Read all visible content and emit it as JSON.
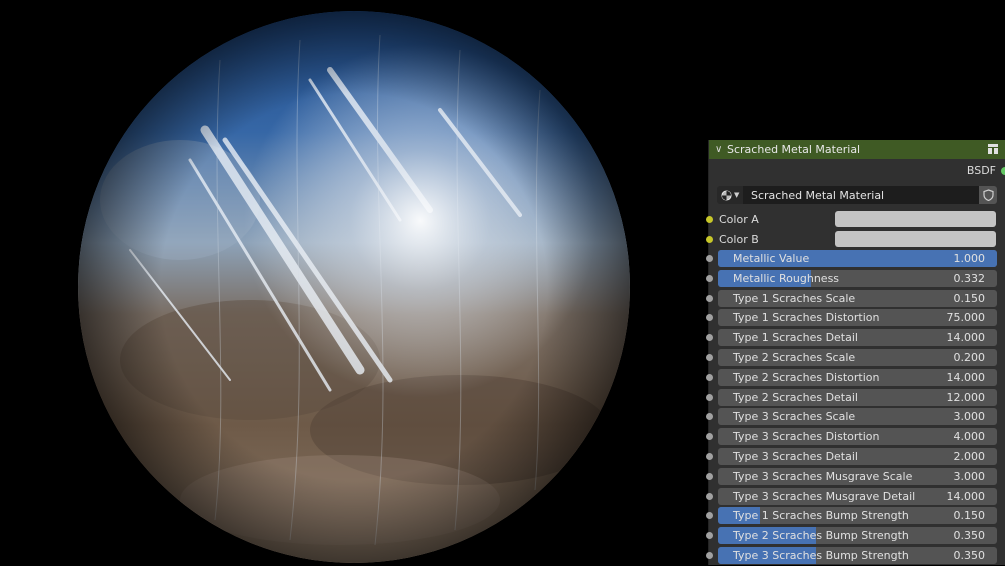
{
  "node": {
    "title": "Scrached Metal Material",
    "output_label": "BSDF",
    "group_name": "Scrached Metal Material",
    "colors": {
      "header": "#3f5a24",
      "body": "#303030",
      "field": "#545454",
      "fill": "#4772b3",
      "color_socket": "#c7c729",
      "float_socket": "#a1a1a1",
      "bsdf_socket": "#63c763"
    },
    "color_inputs": [
      {
        "label": "Color A",
        "swatch": "#c4c4c4"
      },
      {
        "label": "Color B",
        "swatch": "#c4c4c4"
      }
    ],
    "inputs": [
      {
        "label": "Metallic Value",
        "value": "1.000",
        "fill": 1.0
      },
      {
        "label": "Metallic Roughness",
        "value": "0.332",
        "fill": 0.332
      },
      {
        "label": "Type 1 Scraches Scale",
        "value": "0.150",
        "fill": 0
      },
      {
        "label": "Type 1 Scraches Distortion",
        "value": "75.000",
        "fill": 0
      },
      {
        "label": "Type 1 Scraches Detail",
        "value": "14.000",
        "fill": 0
      },
      {
        "label": "Type 2 Scraches Scale",
        "value": "0.200",
        "fill": 0
      },
      {
        "label": "Type 2 Scraches Distortion",
        "value": "14.000",
        "fill": 0
      },
      {
        "label": "Type 2 Scraches Detail",
        "value": "12.000",
        "fill": 0
      },
      {
        "label": "Type 3 Scraches Scale",
        "value": "3.000",
        "fill": 0
      },
      {
        "label": "Type 3 Scraches Distortion",
        "value": "4.000",
        "fill": 0
      },
      {
        "label": "Type 3 Scraches Detail",
        "value": "2.000",
        "fill": 0
      },
      {
        "label": "Type 3 Scraches Musgrave Scale",
        "value": "3.000",
        "fill": 0
      },
      {
        "label": "Type 3 Scraches Musgrave Detail",
        "value": "14.000",
        "fill": 0
      },
      {
        "label": "Type 1 Scraches Bump Strength",
        "value": "0.150",
        "fill": 0.15
      },
      {
        "label": "Type 2 Scraches Bump Strength",
        "value": "0.350",
        "fill": 0.35
      },
      {
        "label": "Type 3 Scraches Bump Strength",
        "value": "0.350",
        "fill": 0.35
      }
    ]
  }
}
